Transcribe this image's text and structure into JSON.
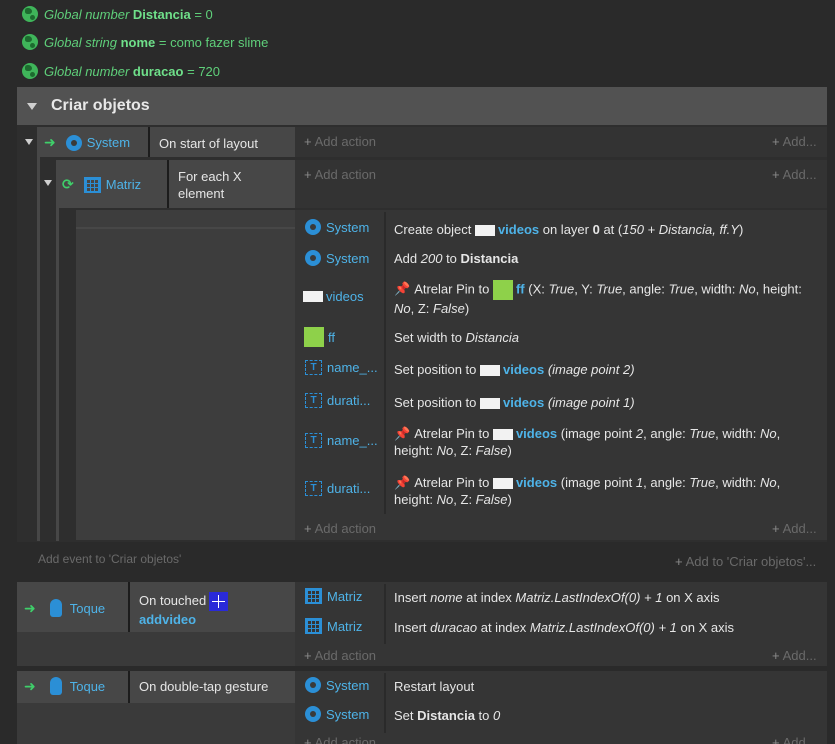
{
  "globals": [
    {
      "prefix": "Global number",
      "name": "Distancia",
      "suffix": "= 0"
    },
    {
      "prefix": "Global string",
      "name": "nome",
      "suffix": "= como fazer slime"
    },
    {
      "prefix": "Global number",
      "name": "duracao",
      "suffix": "= 720"
    }
  ],
  "group": {
    "title": "Criar objetos",
    "add_event": "Add event to 'Criar objetos'",
    "add_to": "Add to 'Criar objetos'..."
  },
  "common": {
    "add_action": "Add action",
    "add_more": "Add..."
  },
  "event1": {
    "object": "System",
    "condition": "On start of layout"
  },
  "event2": {
    "object": "Matriz",
    "condition_line1": "For each X",
    "condition_line2": "element"
  },
  "actions_main": [
    {
      "object": "System",
      "icon": "gear-icon",
      "parts": [
        "Create object ",
        "videos",
        " on layer ",
        "0",
        " at (",
        "150 + Distancia, ff.Y",
        ")"
      ]
    },
    {
      "object": "System",
      "icon": "gear-icon",
      "parts": [
        "Add ",
        "200",
        " to ",
        "Distancia"
      ]
    },
    {
      "object": "videos",
      "icon": "white-swatch",
      "line1_parts": [
        "Atrelar Pin to ",
        "ff",
        " (X: ",
        "True",
        ", Y: ",
        "True",
        ", angle: ",
        "True",
        ", width: ",
        "No",
        ", height:"
      ],
      "line2_parts": [
        "No",
        ", Z: ",
        "False",
        ")"
      ]
    },
    {
      "object": "ff",
      "icon": "green-swatch",
      "parts": [
        "Set width to ",
        "Distancia"
      ]
    },
    {
      "object": "name_...",
      "icon": "text-icon",
      "parts": [
        "Set position to ",
        "videos",
        " ",
        "(image point 2)"
      ]
    },
    {
      "object": "durati...",
      "icon": "text-icon",
      "parts": [
        "Set position to ",
        "videos",
        " ",
        "(image point 1)"
      ]
    },
    {
      "object": "name_...",
      "icon": "text-icon",
      "line1_parts": [
        "Atrelar Pin to ",
        "videos",
        " (image point ",
        "2",
        ", angle: ",
        "True",
        ", width: ",
        "No",
        ","
      ],
      "line2_parts": [
        "height: ",
        "No",
        ", Z: ",
        "False",
        ")"
      ]
    },
    {
      "object": "durati...",
      "icon": "text-icon",
      "line1_parts": [
        "Atrelar Pin to ",
        "videos",
        " (image point ",
        "1",
        ", angle: ",
        "True",
        ", width: ",
        "No",
        ","
      ],
      "line2_parts": [
        "height: ",
        "No",
        ", Z: ",
        "False",
        ")"
      ]
    }
  ],
  "event3": {
    "object": "Toque",
    "condition_line1": "On touched",
    "condition_obj": "addvideo",
    "actions": [
      {
        "object": "Matriz",
        "parts": [
          "Insert ",
          "nome",
          " at index ",
          "Matriz.LastIndexOf(0) + 1",
          " on X axis"
        ]
      },
      {
        "object": "Matriz",
        "parts": [
          "Insert ",
          "duracao",
          " at index ",
          "Matriz.LastIndexOf(0) + 1",
          " on X axis"
        ]
      }
    ]
  },
  "event4": {
    "object": "Toque",
    "condition": "On double-tap gesture",
    "actions": [
      {
        "object": "System",
        "text": "Restart layout"
      },
      {
        "object": "System",
        "parts": [
          "Set ",
          "Distancia",
          " to ",
          "0"
        ]
      }
    ]
  },
  "colors": {
    "background": "#2a2a2a",
    "group_header": "#525252",
    "object_blue": "#4eb3e8",
    "global_green": "#5fcf7a"
  }
}
